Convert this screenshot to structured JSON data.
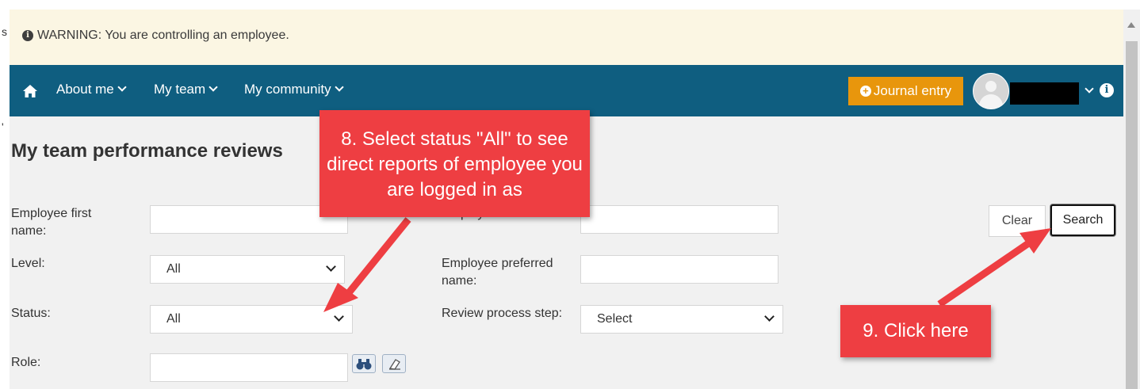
{
  "warning": {
    "icon": "info-circle-icon",
    "text": "WARNING: You are controlling an employee."
  },
  "navbar": {
    "background": "#0f5e80",
    "home_icon": "home-icon",
    "items": [
      {
        "label": "About me"
      },
      {
        "label": "My team"
      },
      {
        "label": "My community"
      }
    ],
    "journal_button": "Journal entry",
    "journal_color": "#e8960c"
  },
  "page": {
    "title": "My team performance reviews"
  },
  "form": {
    "first_name_label": "Employee first name:",
    "first_name_value": "",
    "last_name_label": "Employee last name:",
    "last_name_value": "",
    "level_label": "Level:",
    "level_value": "All",
    "preferred_name_label": "Employee preferred name:",
    "preferred_name_value": "",
    "status_label": "Status:",
    "status_value": "All",
    "review_step_label": "Review process step:",
    "review_step_value": "Select",
    "role_label": "Role:",
    "role_value": "",
    "clear_label": "Clear",
    "search_label": "Search"
  },
  "callouts": {
    "step8": "8. Select status \"All\" to see direct reports of employee you are logged in as",
    "step9": "9. Click here",
    "color": "#ee3e42"
  }
}
